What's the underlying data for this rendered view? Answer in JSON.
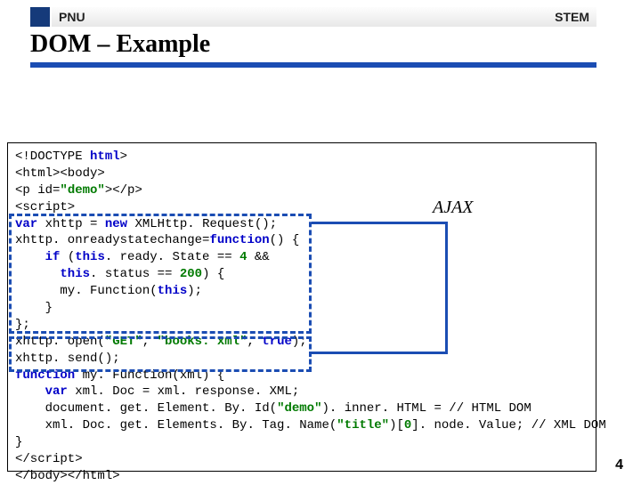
{
  "header": {
    "left": "PNU",
    "right": "STEM"
  },
  "title": "DOM – Example",
  "callout": {
    "label": "AJAX"
  },
  "code": {
    "l1a": "<!DOCTYPE ",
    "l1b": "html",
    "l1c": ">",
    "l2": "<html><body>",
    "l3a": "<p id=",
    "l3b": "\"demo\"",
    "l3c": "></p>",
    "l4": "<script>",
    "l5a": "var",
    "l5b": " xhttp = ",
    "l5c": "new",
    "l5d": " XMLHttp. Request();",
    "l6a": "xhttp. onreadystatechange=",
    "l6b": "function",
    "l6c": "() {",
    "l7a": "    if",
    "l7b": " (",
    "l7c": "this",
    "l7d": ". ready. State == ",
    "l7e": "4",
    "l7f": " &&",
    "l8a": "      this",
    "l8b": ". status == ",
    "l8c": "200",
    "l8d": ") {",
    "l9a": "      my. Function(",
    "l9b": "this",
    "l9c": ");",
    "l10": "    }",
    "l11": "};",
    "l12a": "xhttp. open(",
    "l12b": "\"GET\"",
    "l12c": ", ",
    "l12d": "\"books. xml\"",
    "l12e": ", ",
    "l12f": "true",
    "l12g": ");",
    "l13": "xhttp. send();",
    "l14a": "function",
    "l14b": " my. Function(xml) {",
    "l15a": "    var",
    "l15b": " xml. Doc = xml. response. XML;",
    "l16a": "    document. get. Element. By. Id(",
    "l16b": "\"demo\"",
    "l16c": "). inner. HTML = // HTML DOM",
    "l17a": "    xml. Doc. get. Elements. By. Tag. Name(",
    "l17b": "\"title\"",
    "l17c": ")[",
    "l17d": "0",
    "l17e": "]. node. Value; // XML DOM",
    "l18": "}",
    "l19": "</script>",
    "l20": "</body></html>"
  },
  "pageNumber": "4"
}
